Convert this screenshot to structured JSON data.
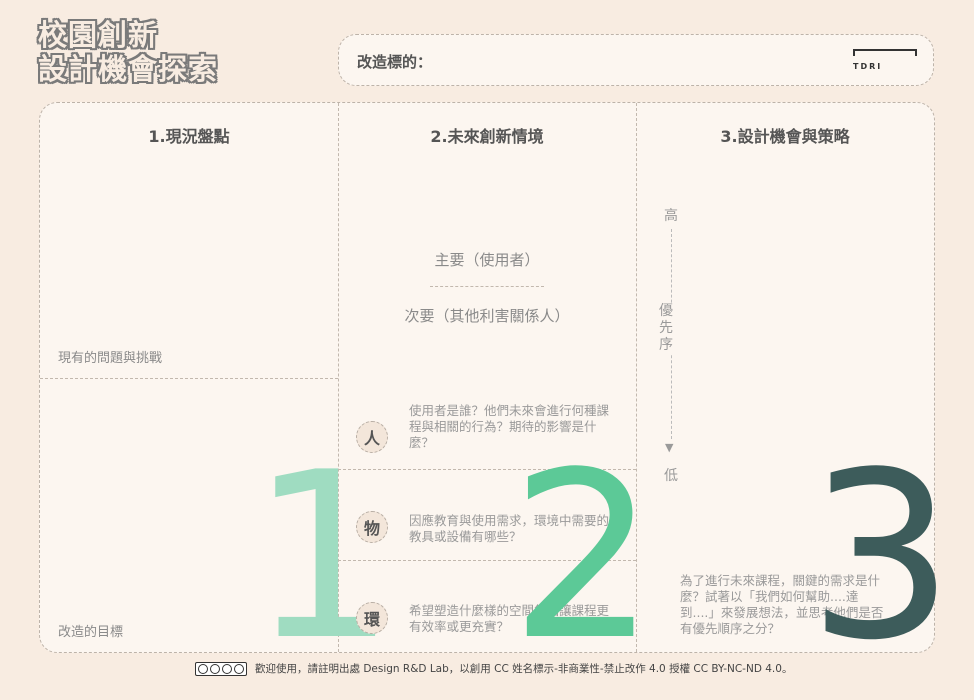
{
  "title": {
    "line1": "校園創新",
    "line2": "設計機會探索"
  },
  "header": {
    "label": "改造標的：",
    "logo_text": "TDRI"
  },
  "columns": {
    "col1": {
      "title": "1.現況盤點",
      "top_label": "現有的問題與挑戰",
      "bottom_label": "改造的目標",
      "number": "1"
    },
    "col2": {
      "title": "2.未來創新情境",
      "primary": "主要（使用者）",
      "secondary": "次要（其他利害關係人）",
      "number": "2",
      "rows": [
        {
          "badge": "人",
          "text": "使用者是誰？他們未來會進行何種課程與相關的行為？期待的影響是什麼？"
        },
        {
          "badge": "物",
          "text": "因應教育與使用需求，環境中需要的教具或設備有哪些？"
        },
        {
          "badge": "環",
          "text": "希望塑造什麼樣的空間氛圍讓課程更有效率或更充實？"
        }
      ]
    },
    "col3": {
      "title": "3.設計機會與策略",
      "high": "高",
      "priority": "優先序",
      "low": "低",
      "note": "為了進行未來課程，關鍵的需求是什麼？試著以「我們如何幫助....達到....」來發展想法，並思考他們是否有優先順序之分？",
      "number": "3"
    }
  },
  "footer": {
    "text": "歡迎使用，請註明出處 Design R&D Lab，以創用 CC 姓名標示-非商業性-禁止改作 4.0 授權 CC BY-NC-ND 4.0。"
  },
  "colors": {
    "num1": "#9fdcc1",
    "num2": "#5cc997",
    "num3": "#3d5c5b"
  }
}
